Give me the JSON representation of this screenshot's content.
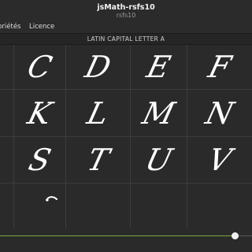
{
  "window": {
    "title": "jsMath-rsfs10",
    "subtitle": "rsfs10"
  },
  "menu": {
    "items": [
      "priétés",
      "Licence"
    ]
  },
  "header": {
    "label": "LATIN CAPITAL LETTER A"
  },
  "grid": {
    "rows": [
      [
        "",
        "C",
        "D",
        "E",
        "F"
      ],
      [
        "",
        "K",
        "L",
        "M",
        "N"
      ],
      [
        "",
        "S",
        "T",
        "U",
        "V"
      ],
      [
        "",
        "",
        "",
        "",
        ""
      ]
    ]
  },
  "slider": {
    "value": 0.93,
    "accent_color": "#7bab3a"
  }
}
